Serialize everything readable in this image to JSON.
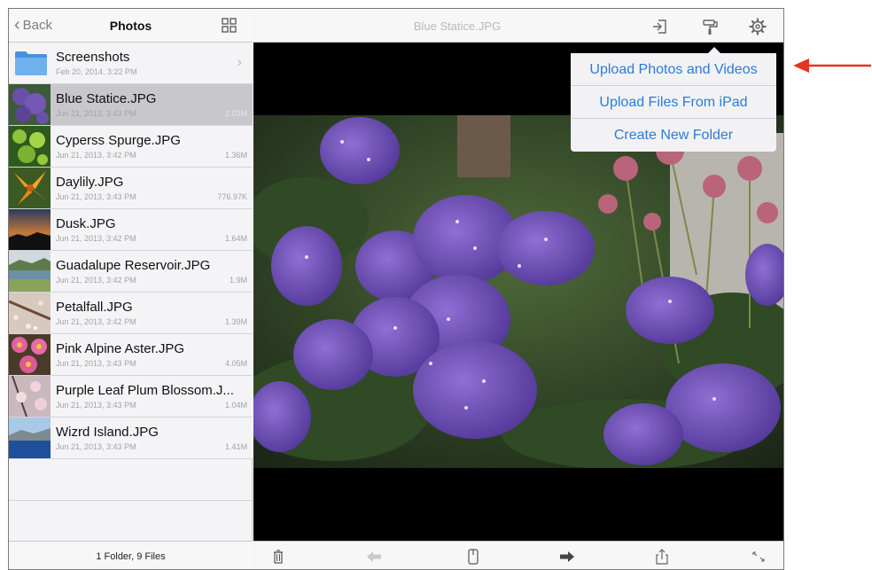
{
  "sidebar": {
    "back_label": "Back",
    "title": "Photos",
    "footer": "1 Folder, 9 Files",
    "items": [
      {
        "name": "Screenshots",
        "date": "Feb 20, 2014, 3:22 PM",
        "size": "",
        "type": "folder"
      },
      {
        "name": "Blue Statice.JPG",
        "date": "Jun 21, 2013, 3:43 PM",
        "size": "2.02M",
        "type": "file"
      },
      {
        "name": "Cyperss Spurge.JPG",
        "date": "Jun 21, 2013, 3:42 PM",
        "size": "1.36M",
        "type": "file"
      },
      {
        "name": "Daylily.JPG",
        "date": "Jun 21, 2013, 3:43 PM",
        "size": "776.97K",
        "type": "file"
      },
      {
        "name": "Dusk.JPG",
        "date": "Jun 21, 2013, 3:42 PM",
        "size": "1.64M",
        "type": "file"
      },
      {
        "name": "Guadalupe Reservoir.JPG",
        "date": "Jun 21, 2013, 3:42 PM",
        "size": "1.9M",
        "type": "file"
      },
      {
        "name": "Petalfall.JPG",
        "date": "Jun 21, 2013, 3:42 PM",
        "size": "1.39M",
        "type": "file"
      },
      {
        "name": "Pink Alpine Aster.JPG",
        "date": "Jun 21, 2013, 3:43 PM",
        "size": "4.05M",
        "type": "file"
      },
      {
        "name": "Purple Leaf Plum Blossom.J...",
        "date": "Jun 21, 2013, 3:43 PM",
        "size": "1.04M",
        "type": "file"
      },
      {
        "name": "Wizrd Island.JPG",
        "date": "Jun 21, 2013, 3:43 PM",
        "size": "1.41M",
        "type": "file"
      }
    ]
  },
  "main": {
    "title": "Blue Statice.JPG"
  },
  "menu": {
    "items": [
      {
        "label": "Upload Photos and Videos"
      },
      {
        "label": "Upload Files From iPad"
      },
      {
        "label": "Create New Folder"
      }
    ]
  },
  "colors": {
    "accent": "#2c7bd6",
    "annotation_arrow": "#e8331f",
    "selected_row": "#c8c8cc"
  },
  "icons": {
    "header": [
      "grid-view-icon",
      "exit-icon",
      "paint-roller-icon",
      "gear-icon"
    ],
    "footer": [
      "trash-icon",
      "arrow-left-icon",
      "mouse-icon",
      "arrow-right-icon",
      "share-icon",
      "expand-icon"
    ]
  }
}
